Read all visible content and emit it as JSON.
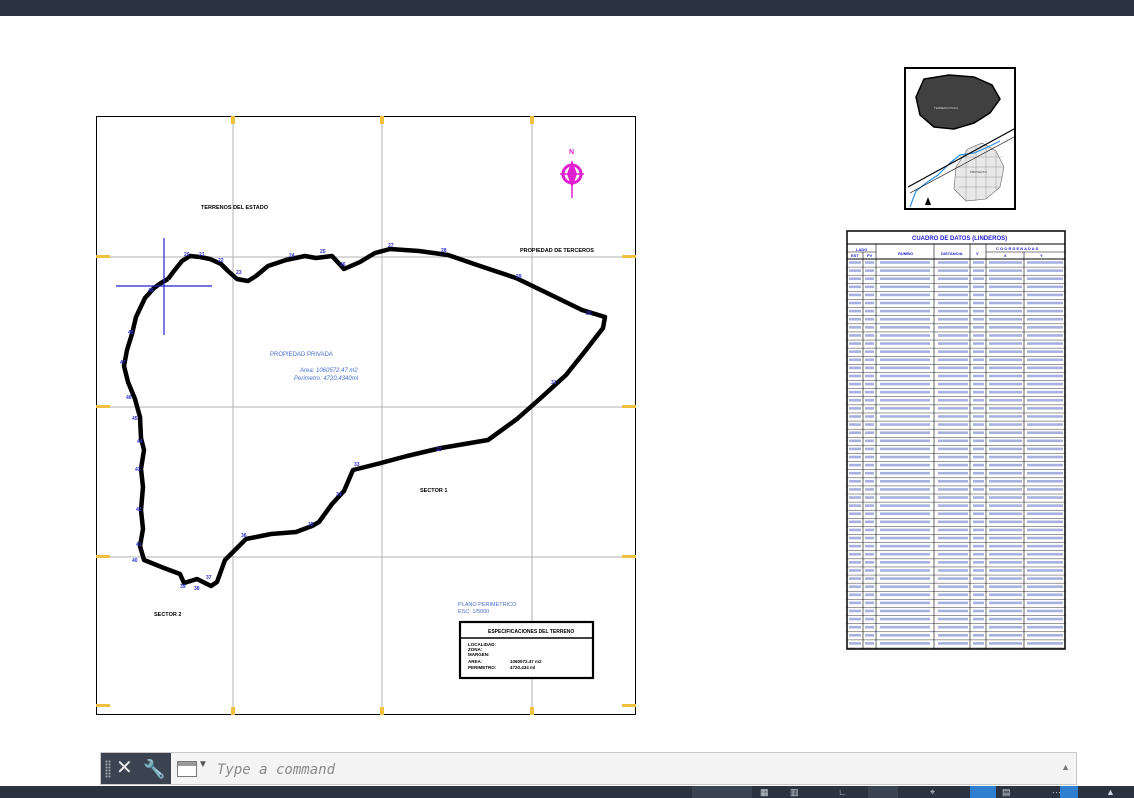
{
  "drawing": {
    "label_terrenos_estado": "TERRENOS DEL ESTADO",
    "label_propiedad_terceros": "PROPIEDAD DE TERCEROS",
    "label_propiedad_privada": "PROPIEDAD PRIVADA",
    "area_text": "Area: 1060572.47 m2",
    "perimetro_text": "Perimetro: 4720.4340ml",
    "label_sector_1": "SECTOR 1",
    "label_sector_2": "SECTOR 2",
    "plano_title": "PLANO PERIMETRICO",
    "plano_scale": "ESC: 1/5000",
    "north_letter": "N",
    "especificaciones": {
      "title": "ESPECIFICACIONES DEL TERRENO",
      "rows": [
        {
          "label": "LOCALIDAD:",
          "value": ""
        },
        {
          "label": "ZONA:",
          "value": ""
        },
        {
          "label": "MARGEN:",
          "value": ""
        },
        {
          "label": "AREA:",
          "value": "1060572.47 m2"
        },
        {
          "label": "PERIMETRO:",
          "value": "4720.434 ml"
        }
      ]
    },
    "vertex_labels": [
      "20",
      "21",
      "22",
      "23",
      "24",
      "25",
      "26",
      "27",
      "28",
      "29",
      "30",
      "31",
      "32",
      "33",
      "34",
      "35",
      "36",
      "37",
      "38",
      "39",
      "40",
      "41",
      "42",
      "43",
      "44",
      "45",
      "46",
      "47",
      "48",
      "49"
    ],
    "location_map": {
      "label_1": "TERRENO POLO",
      "label_2": "PROYECTO"
    }
  },
  "cuadro": {
    "title": "CUADRO DE DATOS (LINDEROS)",
    "col_lado": "LADO",
    "col_est": "EST",
    "col_pv": "PV",
    "col_rumbo": "RUMBO",
    "col_distancia": "DISTANCIA",
    "col_v": "V",
    "col_coordenadas": "C O O R D E N A D A S",
    "col_x": "X",
    "col_y": "Y",
    "row_count": 48
  },
  "command_line": {
    "placeholder": "Type a command"
  },
  "colors": {
    "dark_bar": "#2b3340",
    "grid": "#b0b0b0",
    "perimeter": "#000000",
    "vertex_label": "#3030d0",
    "note_blue": "#4a6fd0",
    "north_arrow": "#e020d0",
    "axis_marks": "#f0c040",
    "ucs_blue": "#2020d0"
  }
}
